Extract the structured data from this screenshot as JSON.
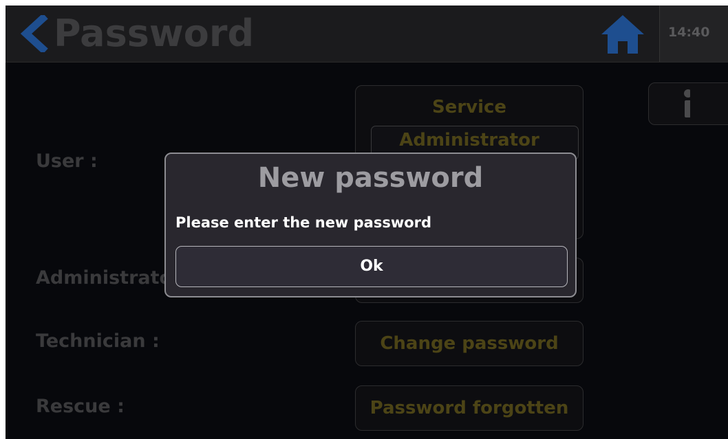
{
  "header": {
    "title": "Password",
    "time": "14:40"
  },
  "rows": {
    "user_label": "User :",
    "administrator_label": "Administrator :",
    "technician_label": "Technician :",
    "rescue_label": "Rescue :"
  },
  "user_select": {
    "options": [
      "Service",
      "Administrator"
    ],
    "selected": "Administrator"
  },
  "buttons": {
    "technician": "Change password",
    "rescue": "Password forgotten"
  },
  "dialog": {
    "title": "New password",
    "message": "Please enter the new password",
    "ok_label": "Ok"
  },
  "colors": {
    "accent_blue": "#1e4e8f",
    "dim_gold": "#4c4416",
    "background": "#07080c"
  },
  "icons": {
    "back": "chevron-left-icon",
    "home": "home-icon",
    "info": "info-icon"
  }
}
